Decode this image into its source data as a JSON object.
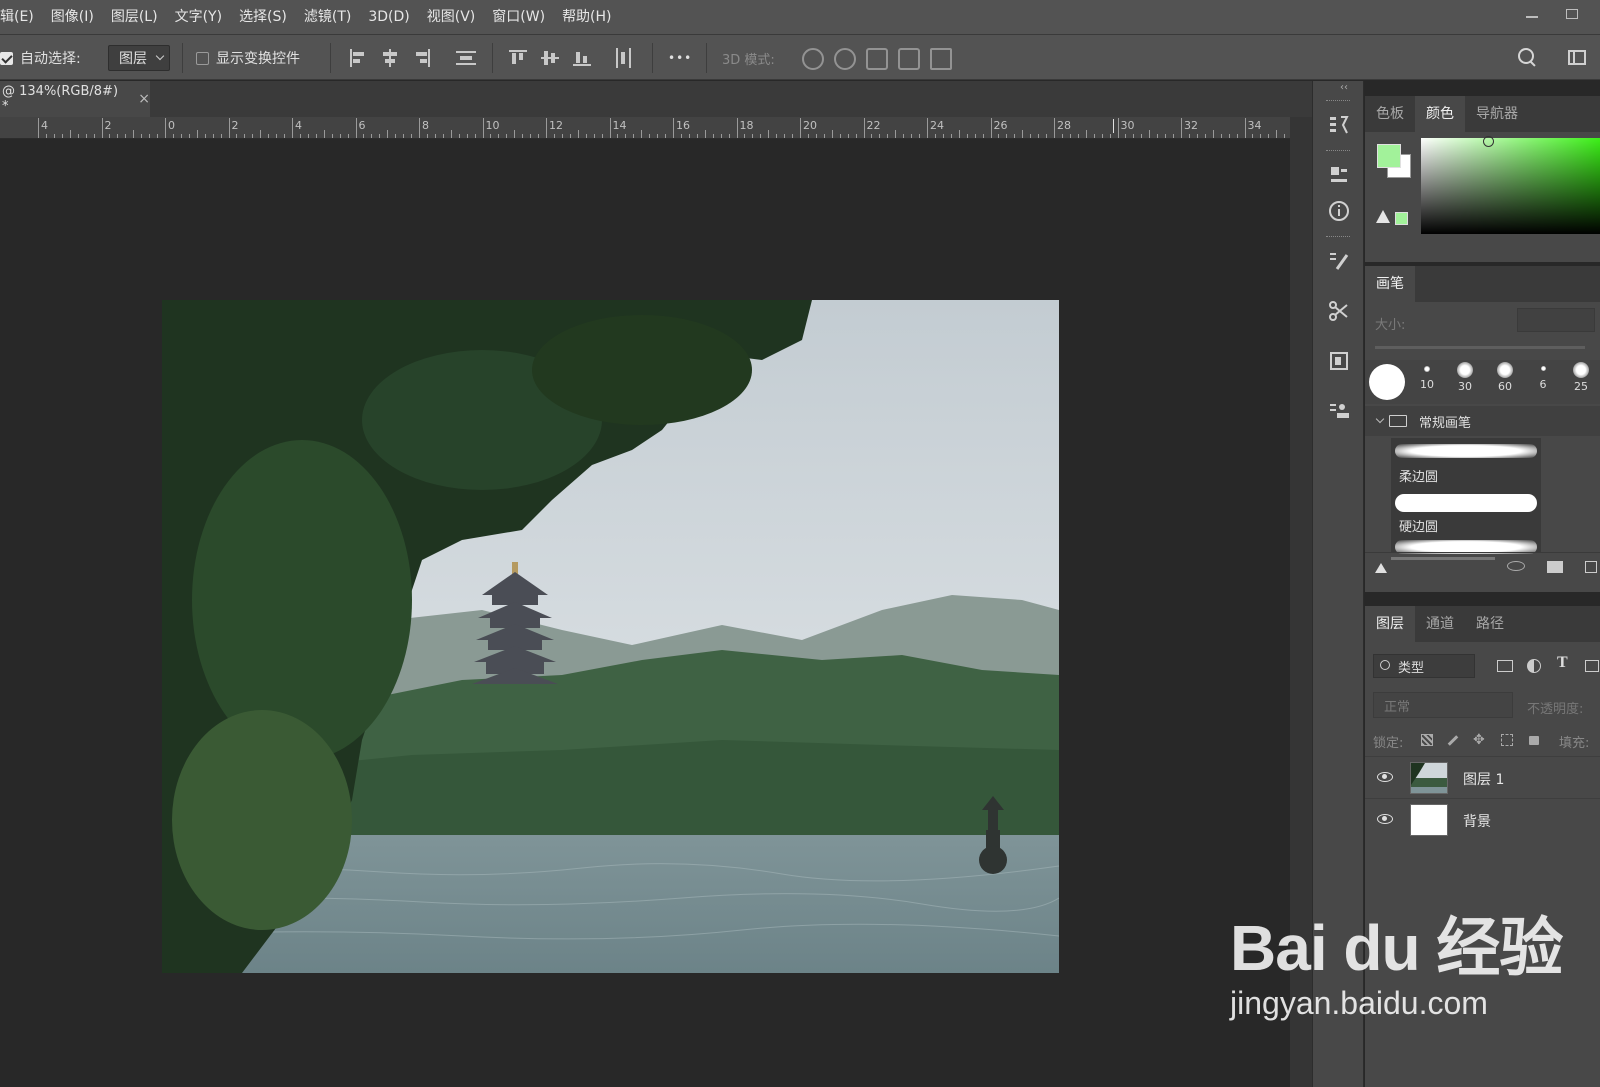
{
  "menu": [
    "辑(E)",
    "图像(I)",
    "图层(L)",
    "文字(Y)",
    "选择(S)",
    "滤镜(T)",
    "3D(D)",
    "视图(V)",
    "窗口(W)",
    "帮助(H)"
  ],
  "options": {
    "auto_select_label": "自动选择:",
    "auto_select_checked": true,
    "auto_select_target": "图层",
    "show_transform_label": "显示变换控件",
    "more_label": "•••",
    "mode3d_label": "3D 模式:"
  },
  "document": {
    "tab_title": "@ 134%(RGB/8#) *",
    "close_label": "×"
  },
  "ruler": {
    "labels": [
      "4",
      "2",
      "0",
      "2",
      "4",
      "6",
      "8",
      "10",
      "12",
      "14",
      "16",
      "18",
      "20",
      "22",
      "24",
      "26",
      "28",
      "30",
      "32",
      "34"
    ]
  },
  "color_panel": {
    "tabs": [
      "色板",
      "颜色",
      "导航器"
    ],
    "active_tab": "颜色",
    "foreground_color": "#a2f29a",
    "background_color": "#ffffff"
  },
  "brush_panel": {
    "title": "画笔",
    "size_label": "大小:",
    "presets": [
      "10",
      "30",
      "60",
      "6",
      "25"
    ],
    "group_name": "常规画笔",
    "brushes": [
      "柔边圆",
      "硬边圆"
    ]
  },
  "layers_panel": {
    "tabs": [
      "图层",
      "通道",
      "路径"
    ],
    "active_tab": "图层",
    "filter_label": "类型",
    "blend_mode": "正常",
    "opacity_label": "不透明度:",
    "lock_label": "锁定:",
    "fill_label": "填充:",
    "layers": [
      {
        "name": "图层 1",
        "visible": true
      },
      {
        "name": "背景",
        "visible": true
      }
    ]
  },
  "watermark": {
    "main": "Bai du 经验",
    "sub": "jingyan.baidu.com"
  }
}
